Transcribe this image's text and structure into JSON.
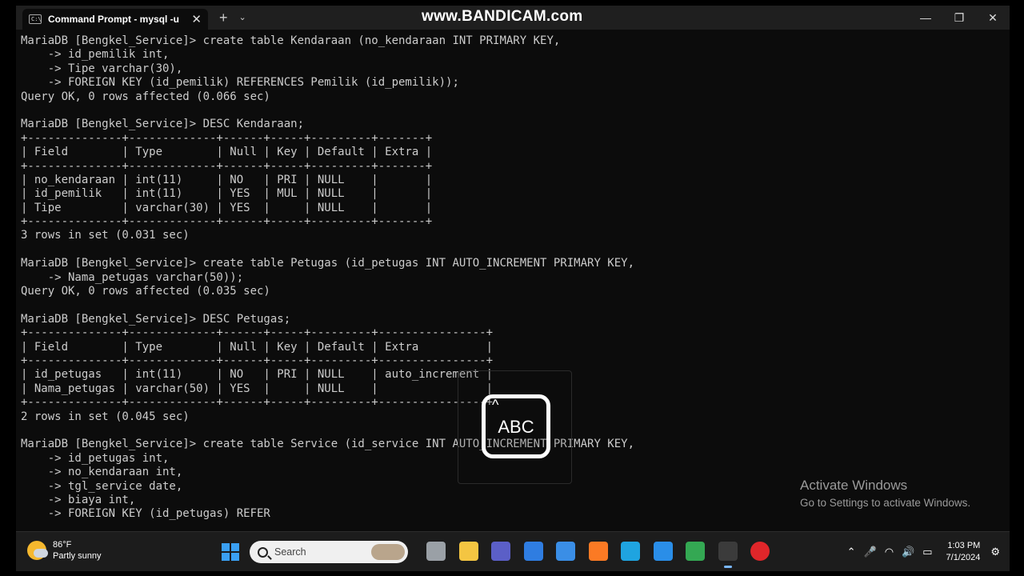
{
  "window": {
    "tab_title": "Command Prompt - mysql  -u",
    "tab_icon_text": "C:\\",
    "watermark": "www.BANDICAM.com",
    "new_tab": "+",
    "tab_dropdown": "⌄",
    "controls": {
      "minimize": "—",
      "maximize": "❐",
      "close": "✕"
    }
  },
  "console": {
    "lines": [
      "MariaDB [Bengkel_Service]> create table Kendaraan (no_kendaraan INT PRIMARY KEY,",
      "    -> id_pemilik int,",
      "    -> Tipe varchar(30),",
      "    -> FOREIGN KEY (id_pemilik) REFERENCES Pemilik (id_pemilik));",
      "Query OK, 0 rows affected (0.066 sec)",
      "",
      "MariaDB [Bengkel_Service]> DESC Kendaraan;",
      "+--------------+-------------+------+-----+---------+-------+",
      "| Field        | Type        | Null | Key | Default | Extra |",
      "+--------------+-------------+------+-----+---------+-------+",
      "| no_kendaraan | int(11)     | NO   | PRI | NULL    |       |",
      "| id_pemilik   | int(11)     | YES  | MUL | NULL    |       |",
      "| Tipe         | varchar(30) | YES  |     | NULL    |       |",
      "+--------------+-------------+------+-----+---------+-------+",
      "3 rows in set (0.031 sec)",
      "",
      "MariaDB [Bengkel_Service]> create table Petugas (id_petugas INT AUTO_INCREMENT PRIMARY KEY,",
      "    -> Nama_petugas varchar(50));",
      "Query OK, 0 rows affected (0.035 sec)",
      "",
      "MariaDB [Bengkel_Service]> DESC Petugas;",
      "+--------------+-------------+------+-----+---------+----------------+",
      "| Field        | Type        | Null | Key | Default | Extra          |",
      "+--------------+-------------+------+-----+---------+----------------+",
      "| id_petugas   | int(11)     | NO   | PRI | NULL    | auto_increment |",
      "| Nama_petugas | varchar(50) | YES  |     | NULL    |                |",
      "+--------------+-------------+------+-----+---------+----------------+",
      "2 rows in set (0.045 sec)",
      "",
      "MariaDB [Bengkel_Service]> create table Service (id_service INT AUTO_INCREMENT PRIMARY KEY,",
      "    -> id_petugas int,",
      "    -> no_kendaraan int,",
      "    -> tgl_service date,",
      "    -> biaya int,",
      "    -> FOREIGN KEY (id_petugas) REFER"
    ]
  },
  "ime_indicator": {
    "label": "ABC",
    "caret": "^"
  },
  "activate_windows": {
    "title": "Activate Windows",
    "subtitle": "Go to Settings to activate Windows."
  },
  "taskbar": {
    "weather": {
      "temp": "86°F",
      "condition": "Partly sunny"
    },
    "search_placeholder": "Search",
    "apps": [
      {
        "name": "task-view-app",
        "color": "#9aa0a6"
      },
      {
        "name": "file-explorer-app",
        "color": "#f4c542"
      },
      {
        "name": "teams-app",
        "color": "#5b5fc7"
      },
      {
        "name": "mail-app",
        "color": "#2f7de1"
      },
      {
        "name": "store-app",
        "color": "#3a8ee6"
      },
      {
        "name": "xampp-app",
        "color": "#fb7a24"
      },
      {
        "name": "edge-app",
        "color": "#1fa4e0"
      },
      {
        "name": "vscode-app",
        "color": "#2a8ee8"
      },
      {
        "name": "chrome-app",
        "color": "#34a853"
      },
      {
        "name": "terminal-app",
        "color": "#3b3b3b"
      },
      {
        "name": "bandicam-app",
        "color": "#e0262a"
      }
    ],
    "tray": {
      "chevron": "⌃",
      "mic": "🎤",
      "wifi": "◠",
      "volume": "🔊",
      "battery": "▭"
    },
    "time": "1:03 PM",
    "date": "7/1/2024"
  }
}
